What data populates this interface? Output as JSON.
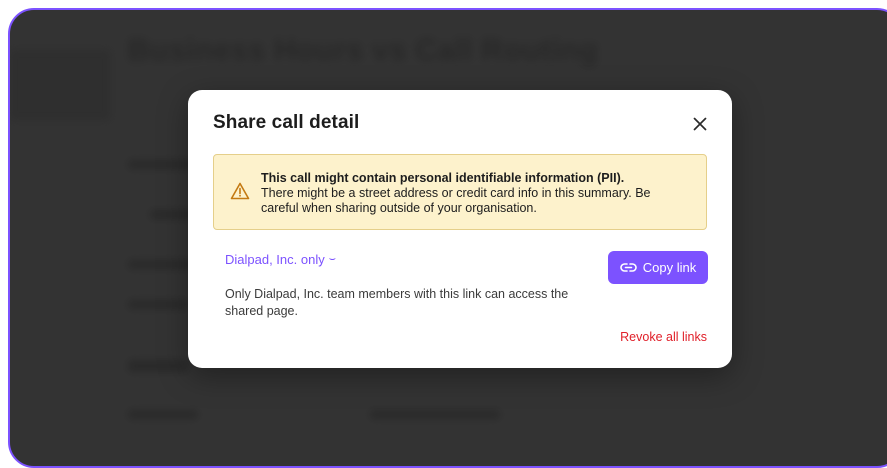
{
  "background": {
    "page_title": "Business Hours vs Call Routing"
  },
  "modal": {
    "title": "Share call detail",
    "close_icon": "close-icon",
    "warning": {
      "icon": "warning-triangle-icon",
      "heading": "This call might contain personal identifiable information (PII).",
      "body": "There might be a street address or credit card info in this summary. Be careful when sharing outside of your organisation."
    },
    "scope": {
      "selected": "Dialpad, Inc. only",
      "chevron_icon": "chevron-down-icon",
      "description": "Only Dialpad, Inc. team members with this link can access the shared page."
    },
    "copy_button": {
      "icon": "link-icon",
      "label": "Copy link"
    },
    "revoke_label": "Revoke all links"
  },
  "colors": {
    "accent": "#7c52ff",
    "danger": "#e0202a",
    "warning_bg": "#fdf2cc",
    "overlay": "#3a3a3a"
  }
}
